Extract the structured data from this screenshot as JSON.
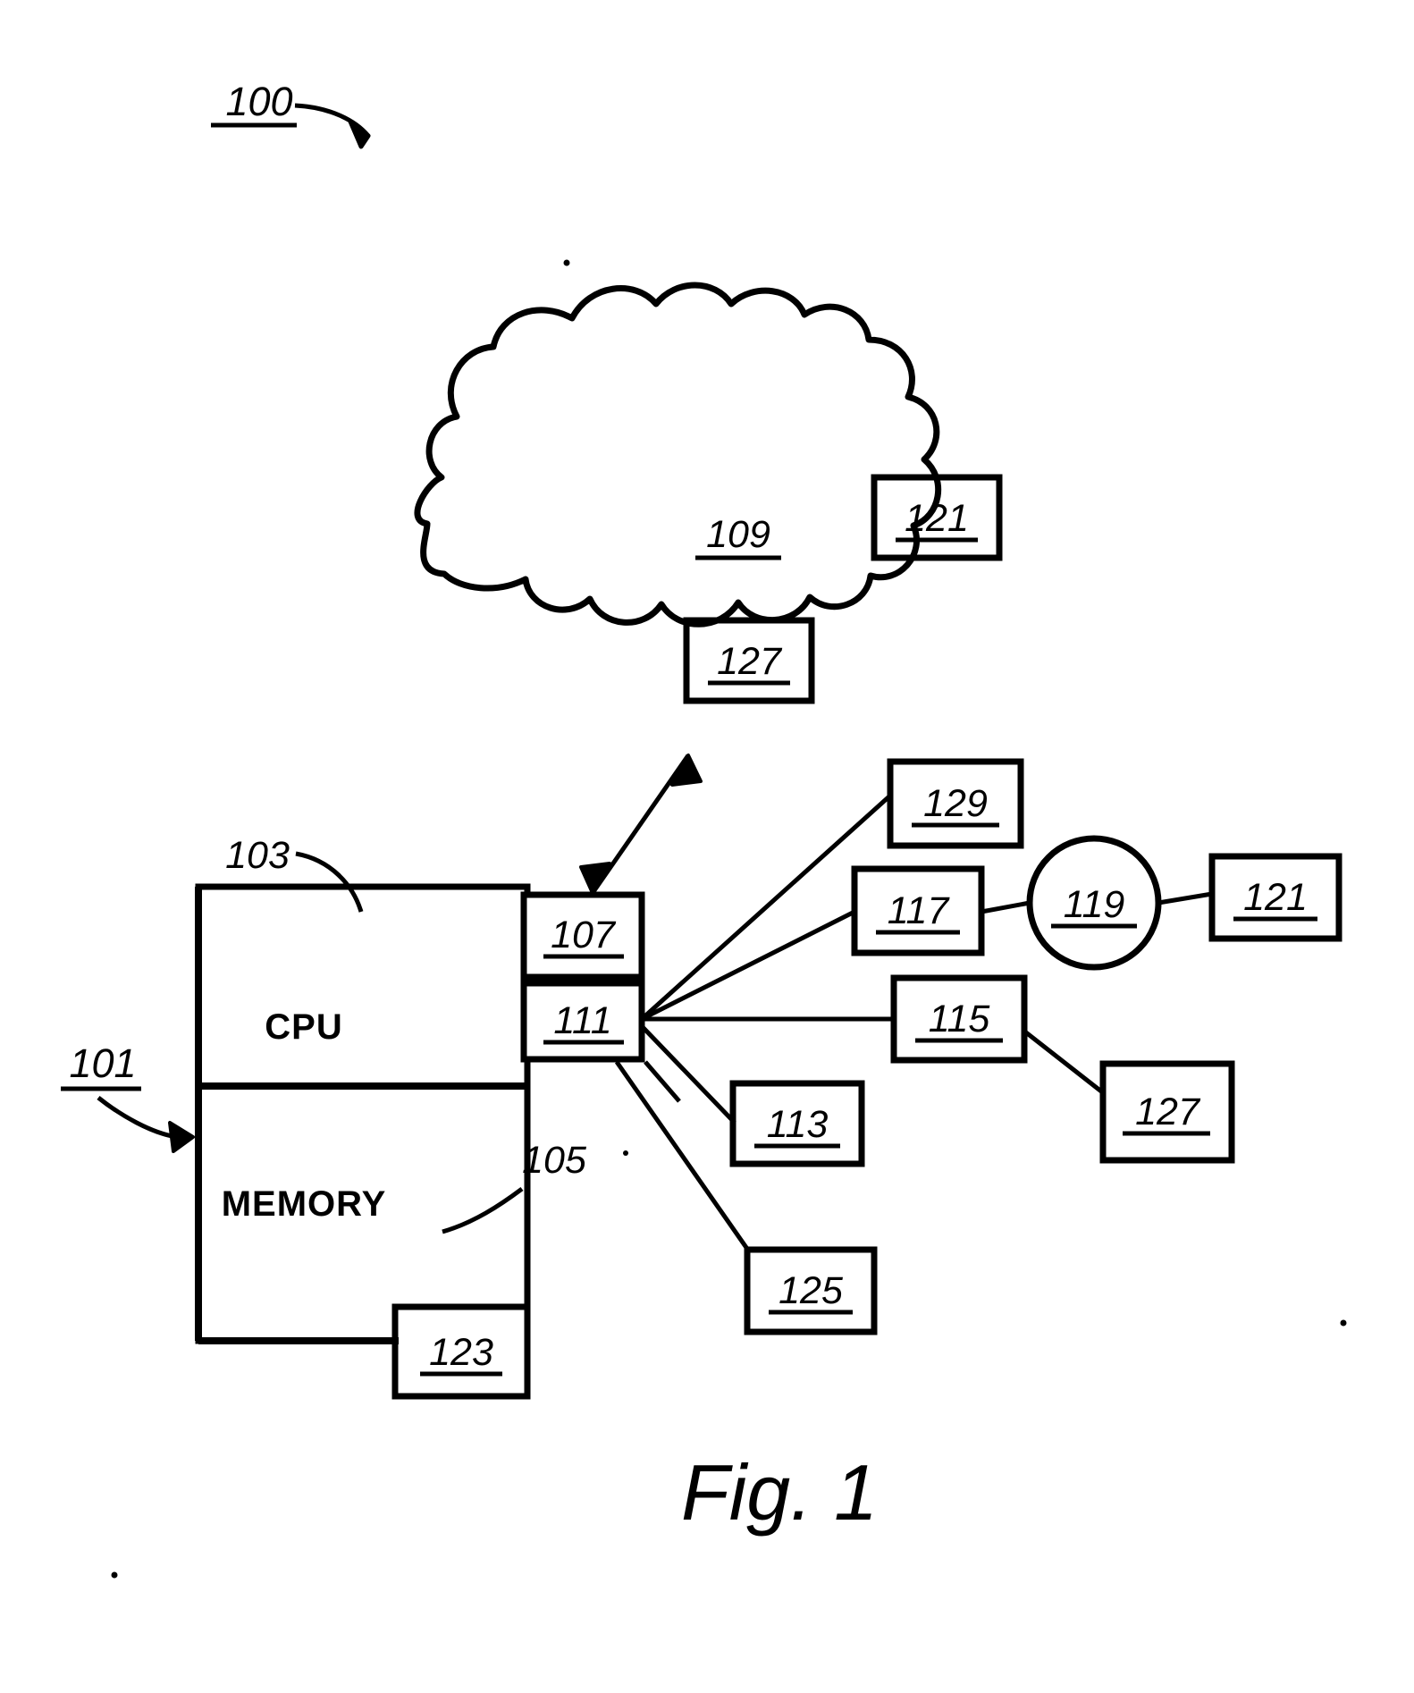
{
  "figure": {
    "caption": "Fig. 1",
    "system_label": "100",
    "labels": {
      "system": "100",
      "computer": "101",
      "cpu_ref": "103",
      "memory_ref": "105",
      "interface_107": "107",
      "network_cloud": "109",
      "bus_111": "111",
      "device_113": "113",
      "device_115": "115",
      "device_117": "117",
      "node_119": "119",
      "device_121": "121",
      "module_123": "123",
      "module_125": "125",
      "module_127": "127",
      "device_129": "129",
      "cloud_device_121": "121",
      "cloud_device_127": "127"
    },
    "blocks": {
      "cpu": "CPU",
      "memory": "MEMORY"
    }
  },
  "elements": [
    {
      "name": "system-label",
      "text": "100"
    },
    {
      "name": "computer-label",
      "text": "101"
    },
    {
      "name": "cpu-leader-label",
      "text": "103"
    },
    {
      "name": "memory-leader-label",
      "text": "105"
    },
    {
      "name": "interface-box-107",
      "text": "107"
    },
    {
      "name": "cloud-label-109",
      "text": "109"
    },
    {
      "name": "bus-box-111",
      "text": "111"
    },
    {
      "name": "box-113",
      "text": "113"
    },
    {
      "name": "box-115",
      "text": "115"
    },
    {
      "name": "box-117",
      "text": "117"
    },
    {
      "name": "circle-119",
      "text": "119"
    },
    {
      "name": "box-121-right",
      "text": "121"
    },
    {
      "name": "box-121-cloud",
      "text": "121"
    },
    {
      "name": "box-123",
      "text": "123"
    },
    {
      "name": "box-125",
      "text": "125"
    },
    {
      "name": "box-127-right",
      "text": "127"
    },
    {
      "name": "box-127-cloud",
      "text": "127"
    },
    {
      "name": "box-129",
      "text": "129"
    }
  ],
  "colors": {
    "ink": "#000000",
    "paper": "#ffffff"
  }
}
